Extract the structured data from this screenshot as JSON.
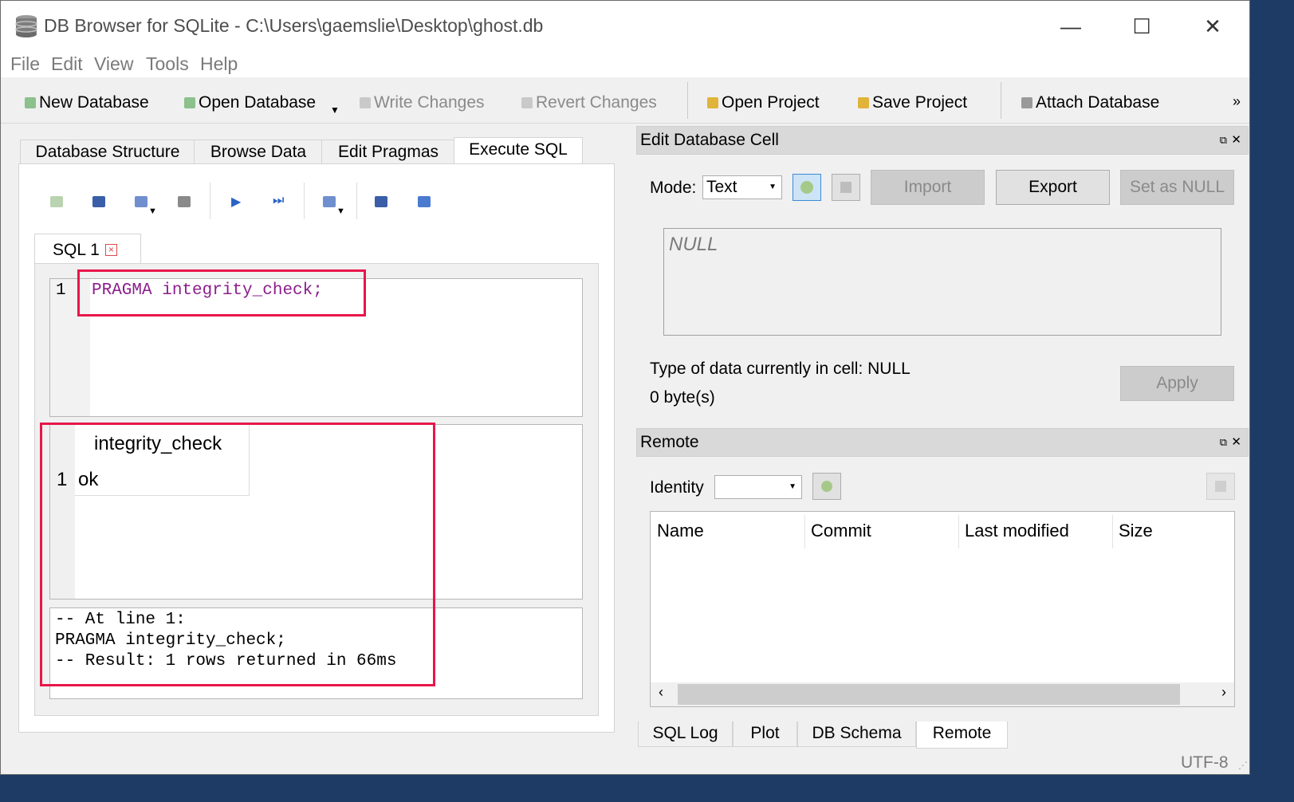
{
  "window": {
    "title": "DB Browser for SQLite - C:\\Users\\gaemslie\\Desktop\\ghost.db"
  },
  "window_controls": {
    "minimize": "—",
    "maximize": "☐",
    "close": "✕"
  },
  "menu": [
    "File",
    "Edit",
    "View",
    "Tools",
    "Help"
  ],
  "toolbar": {
    "new_db": "New Database",
    "open_db": "Open Database",
    "write": "Write Changes",
    "revert": "Revert Changes",
    "open_proj": "Open Project",
    "save_proj": "Save Project",
    "attach": "Attach Database",
    "more": "»"
  },
  "main_tabs": [
    "Database Structure",
    "Browse Data",
    "Edit Pragmas",
    "Execute SQL"
  ],
  "sql_tab": {
    "label": "SQL 1",
    "close": "×"
  },
  "editor": {
    "line_number": "1",
    "code": "PRAGMA integrity_check;"
  },
  "results": {
    "column": "integrity_check",
    "row_number": "1",
    "value": "ok"
  },
  "messages": {
    "line1": "-- At line 1:",
    "line2": "PRAGMA integrity_check;",
    "line3": "-- Result: 1 rows returned in 66ms"
  },
  "edit_cell": {
    "title": "Edit Database Cell",
    "mode_label": "Mode:",
    "mode_value": "Text",
    "import": "Import",
    "export": "Export",
    "set_null": "Set as NULL",
    "cell_value": "NULL",
    "type_info": "Type of data currently in cell: NULL",
    "size_info": "0 byte(s)",
    "apply": "Apply"
  },
  "remote": {
    "title": "Remote",
    "identity_label": "Identity",
    "columns": [
      "Name",
      "Commit",
      "Last modified",
      "Size"
    ]
  },
  "bottom_tabs": [
    "SQL Log",
    "Plot",
    "DB Schema",
    "Remote"
  ],
  "status": {
    "encoding": "UTF-8"
  },
  "colors": {
    "highlight": "#e8164a",
    "keyword": "#8b1e8b"
  }
}
